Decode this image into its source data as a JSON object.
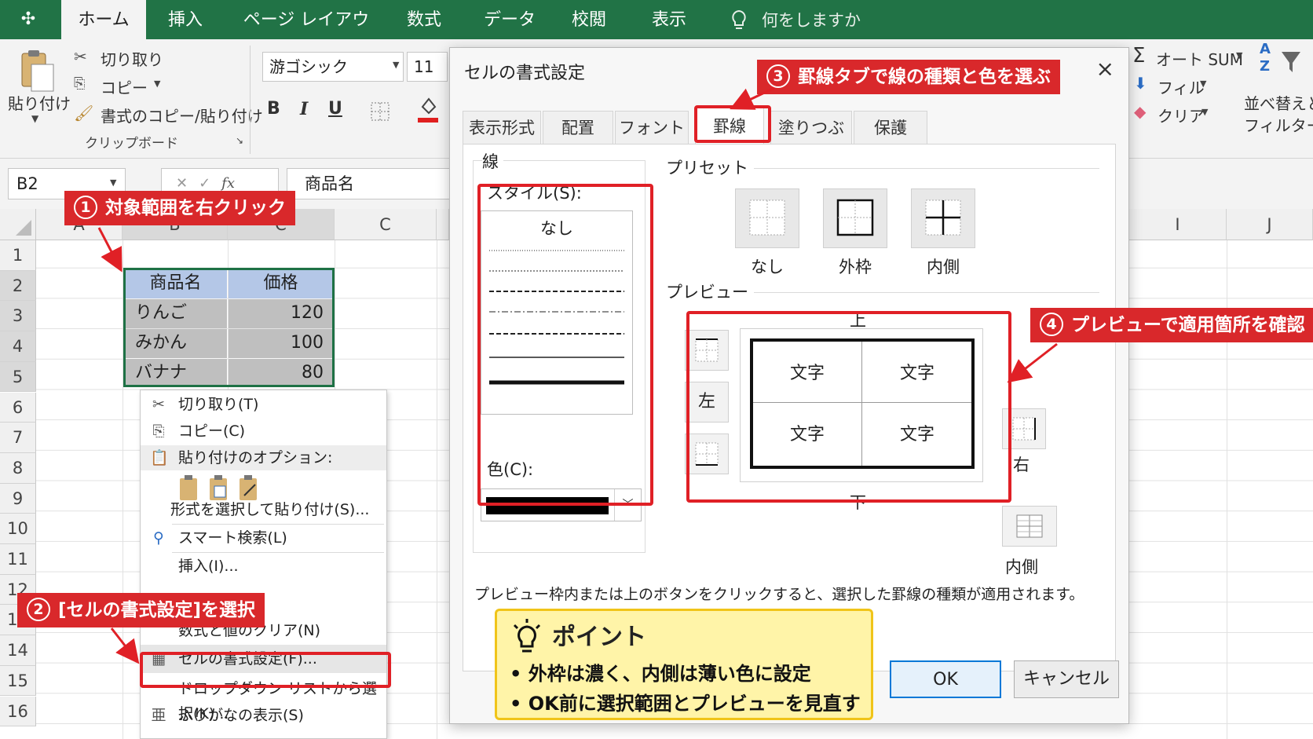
{
  "ribbon": {
    "tabs": [
      "ホーム",
      "挿入",
      "ページ レイアウト",
      "数式",
      "データ",
      "校閲",
      "表示"
    ],
    "tell_me": "何をしますか",
    "paste": "貼り付け",
    "cut": "切り取り",
    "copy": "コピー",
    "format_painter": "書式のコピー/貼り付け",
    "clipboard_group": "クリップボード",
    "font_name": "游ゴシック",
    "font_size": "11",
    "bold": "B",
    "italic": "I",
    "underline": "U",
    "autosum": "オート SUM",
    "fill": "フィル",
    "clear": "クリア",
    "sort_filter_1": "並べ替えと",
    "sort_filter_2": "フィルター",
    "sort_icon": "A Z"
  },
  "formula_bar": {
    "name_box": "B2",
    "fx": "fx",
    "formula": "商品名"
  },
  "grid": {
    "columns": [
      "A",
      "B",
      "C",
      "C",
      "I",
      "J"
    ],
    "rows": [
      "1",
      "2",
      "3",
      "4",
      "5",
      "6",
      "7",
      "8",
      "9",
      "10",
      "11",
      "12",
      "13",
      "14",
      "15",
      "16"
    ],
    "table": {
      "headers": [
        "商品名",
        "価格"
      ],
      "rows": [
        [
          "りんご",
          "120"
        ],
        [
          "みかん",
          "100"
        ],
        [
          "バナナ",
          "80"
        ]
      ]
    }
  },
  "context_menu": {
    "cut": "切り取り(T)",
    "copy": "コピー(C)",
    "paste_options": "貼り付けのオプション:",
    "paste_special": "形式を選択して貼り付け(S)...",
    "smart_lookup": "スマート検索(L)",
    "insert": "挿入(I)...",
    "clear_contents": "数式と値のクリア(N)",
    "format_cells": "セルの書式設定(F)...",
    "pick_list": "ドロップダウン リストから選択(K)...",
    "phonetic": "ふりがなの表示(S)"
  },
  "dialog": {
    "title": "セルの書式設定",
    "close": "×",
    "tabs": [
      "表示形式",
      "配置",
      "フォント",
      "罫線",
      "塗りつぶし",
      "保護"
    ],
    "line_group": "線",
    "style_label": "スタイル(S):",
    "style_none": "なし",
    "color_label": "色(C):",
    "color_value": "#000000",
    "preset_group": "プリセット",
    "presets": [
      "なし",
      "外枠",
      "内側"
    ],
    "preview_group": "プレビュー",
    "top": "上",
    "bottom": "下",
    "left": "左",
    "right": "右",
    "inside": "内側",
    "preview_cells": [
      "文字",
      "文字",
      "文字",
      "文字"
    ],
    "hint": "プレビュー枠内または上のボタンをクリックすると、選択した罫線の種類が適用されます。",
    "ok": "OK",
    "cancel": "キャンセル"
  },
  "annotations": {
    "step1_num": "1",
    "step1": "対象範囲を右クリック",
    "step2_num": "2",
    "step2": "[セルの書式設定]を選択",
    "step3_num": "3",
    "step3": "罫線タブで線の種類と色を選ぶ",
    "step4_num": "4",
    "step4": "プレビューで適用箇所を確認",
    "accent": "#d9282b"
  },
  "point": {
    "title": "ポイント",
    "lines": [
      "• 外枠は濃く、内側は薄い色に設定",
      "• OK前に選択範囲とプレビューを見直す"
    ]
  }
}
